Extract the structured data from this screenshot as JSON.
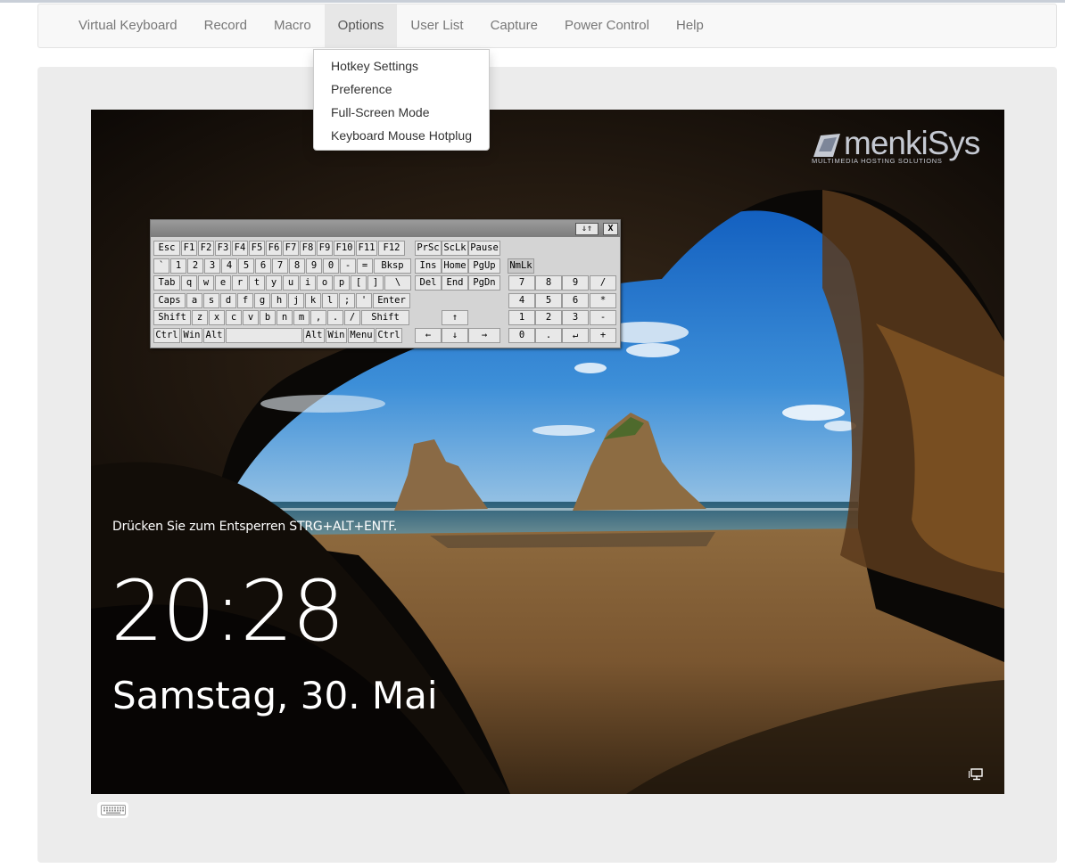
{
  "menu": [
    "Virtual Keyboard",
    "Record",
    "Macro",
    "Options",
    "User List",
    "Capture",
    "Power Control",
    "Help"
  ],
  "active_menu": "Options",
  "options_dropdown": [
    "Hotkey Settings",
    "Preference",
    "Full-Screen Mode",
    "Keyboard Mouse Hotplug"
  ],
  "lockscreen": {
    "prompt": "Drücken Sie zum Entsperren STRG+ALT+ENTF.",
    "time": "20:28",
    "date": "Samstag, 30. Mai"
  },
  "logo": {
    "name": "menkiSys",
    "tagline": "MULTIMEDIA HOSTING SOLUTIONS"
  },
  "vkeyboard": {
    "title_buttons": [
      "⇓⇑",
      "X"
    ],
    "rows": [
      [
        "Esc",
        "F1",
        "F2",
        "F3",
        "F4",
        "F5",
        "F6",
        "F7",
        "F8",
        "F9",
        "F10",
        "F11",
        "F12"
      ],
      [
        "`",
        "1",
        "2",
        "3",
        "4",
        "5",
        "6",
        "7",
        "8",
        "9",
        "0",
        "-",
        "=",
        "Bksp"
      ],
      [
        "Tab",
        "q",
        "w",
        "e",
        "r",
        "t",
        "y",
        "u",
        "i",
        "o",
        "p",
        "[",
        "]",
        "\\"
      ],
      [
        "Caps",
        "a",
        "s",
        "d",
        "f",
        "g",
        "h",
        "j",
        "k",
        "l",
        ";",
        "'",
        "Enter"
      ],
      [
        "Shift",
        "z",
        "x",
        "c",
        "v",
        "b",
        "n",
        "m",
        ",",
        ".",
        "/",
        "Shift"
      ],
      [
        "Ctrl",
        "Win",
        "Alt",
        "",
        "Alt",
        "Win",
        "Menu",
        "Ctrl"
      ]
    ],
    "nav": [
      "PrSc",
      "ScLk",
      "Pause",
      "Ins",
      "Home",
      "PgUp",
      "Del",
      "End",
      "PgDn",
      "↑",
      "←",
      "↓",
      "→"
    ],
    "numpad": [
      "NmLk",
      "7",
      "8",
      "9",
      "/",
      "4",
      "5",
      "6",
      "*",
      "1",
      "2",
      "3",
      "-",
      "0",
      ".",
      "↵",
      "+"
    ]
  },
  "colors": {
    "navbar_bg": "#f8f8f8",
    "active_tab": "#e7e7e7",
    "panel_bg": "#ececec",
    "keyboard_bg": "#d4d4d4"
  }
}
